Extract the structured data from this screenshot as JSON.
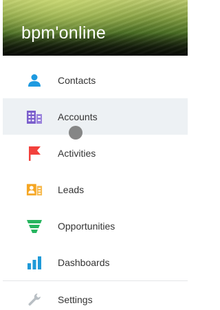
{
  "header": {
    "logo_text": "bpm'online"
  },
  "menu": {
    "items": [
      {
        "label": "Contacts",
        "icon": "contact-icon",
        "color": "#1e9ae0"
      },
      {
        "label": "Accounts",
        "icon": "building-icon",
        "color": "#7b5fcc"
      },
      {
        "label": "Activities",
        "icon": "flag-icon",
        "color": "#f2413c"
      },
      {
        "label": "Leads",
        "icon": "lead-card-icon",
        "color": "#f5a623"
      },
      {
        "label": "Opportunities",
        "icon": "funnel-icon",
        "color": "#27b55f"
      },
      {
        "label": "Dashboards",
        "icon": "bar-chart-icon",
        "color": "#1f9ad8"
      },
      {
        "label": "Settings",
        "icon": "wrench-icon",
        "color": "#b9bfc4"
      }
    ],
    "active_item": "Accounts"
  }
}
